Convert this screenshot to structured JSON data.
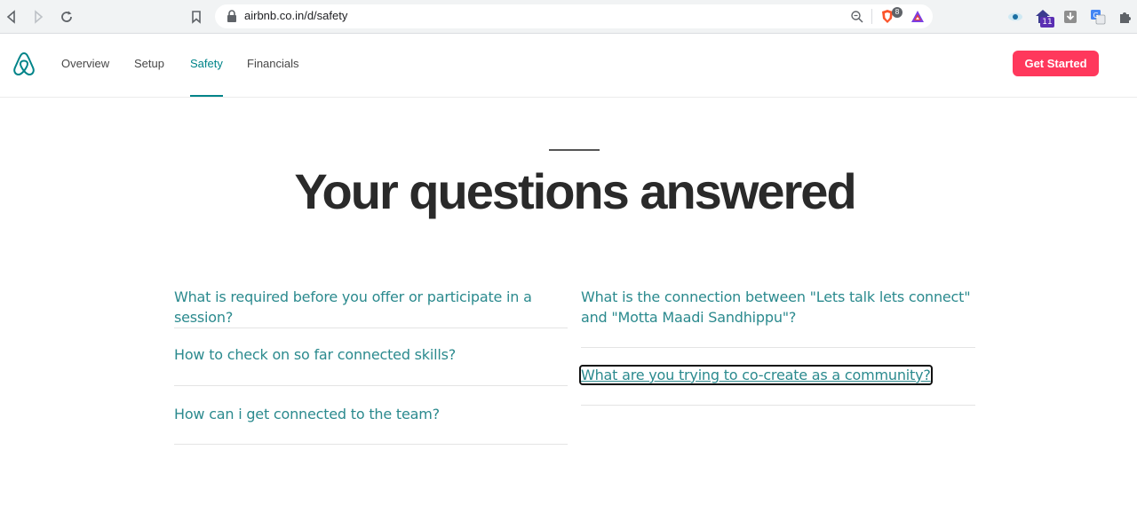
{
  "browser": {
    "url": "airbnb.co.in/d/safety",
    "brave_badge": "8",
    "ext_badge": "11"
  },
  "header": {
    "nav": [
      {
        "label": "Overview"
      },
      {
        "label": "Setup"
      },
      {
        "label": "Safety"
      },
      {
        "label": "Financials"
      }
    ],
    "cta_label": "Get Started",
    "colors": {
      "brand": "#ff385c",
      "accent": "#008489"
    }
  },
  "main": {
    "heading": "Your questions answered",
    "faq_left": [
      {
        "question": "What is required before you offer or participate in a session?"
      },
      {
        "question": "How to check on so far connected skills?"
      },
      {
        "question": "How can i get connected to the team?"
      }
    ],
    "faq_right": [
      {
        "question": "What is the connection between \"Lets talk lets connect\" and \"Motta Maadi Sandhippu\"?"
      },
      {
        "question": "What are you trying to co-create as a community?"
      }
    ]
  }
}
